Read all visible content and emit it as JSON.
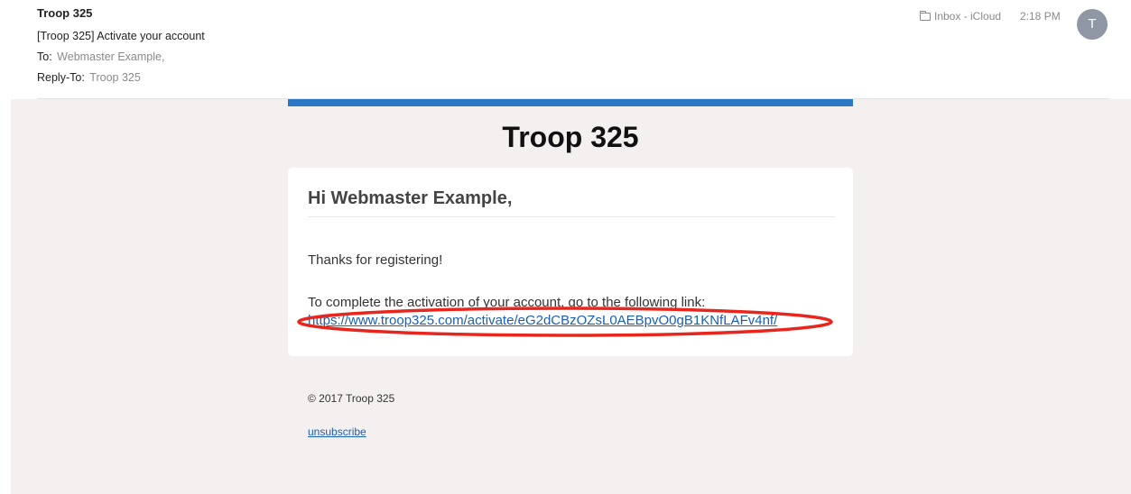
{
  "header": {
    "sender": "Troop 325",
    "subject": "[Troop 325] Activate your account",
    "to_label": "To:",
    "to_value": "Webmaster Example,",
    "reply_to_label": "Reply-To:",
    "reply_to_value": "Troop 325",
    "mailbox": "Inbox - iCloud",
    "time": "2:18 PM",
    "avatar_initial": "T",
    "mailbox_icon": "folder-icon"
  },
  "email": {
    "brand_title": "Troop 325",
    "greeting": "Hi Webmaster Example,",
    "thanks": "Thanks for registering!",
    "instructions": "To complete the activation of your account, go to the following link:",
    "activation_link": "https://www.troop325.com/activate/eG2dCBzOZsL0AEBpvO0gB1KNfLAFv4nf/",
    "copyright": "© 2017 Troop 325",
    "unsubscribe": "unsubscribe"
  },
  "colors": {
    "accent_bar": "#2a77c4",
    "link": "#1a5fb4",
    "highlight_ellipse": "#e8261d",
    "body_background": "#f5f0f0",
    "avatar": "#8e97a3"
  }
}
